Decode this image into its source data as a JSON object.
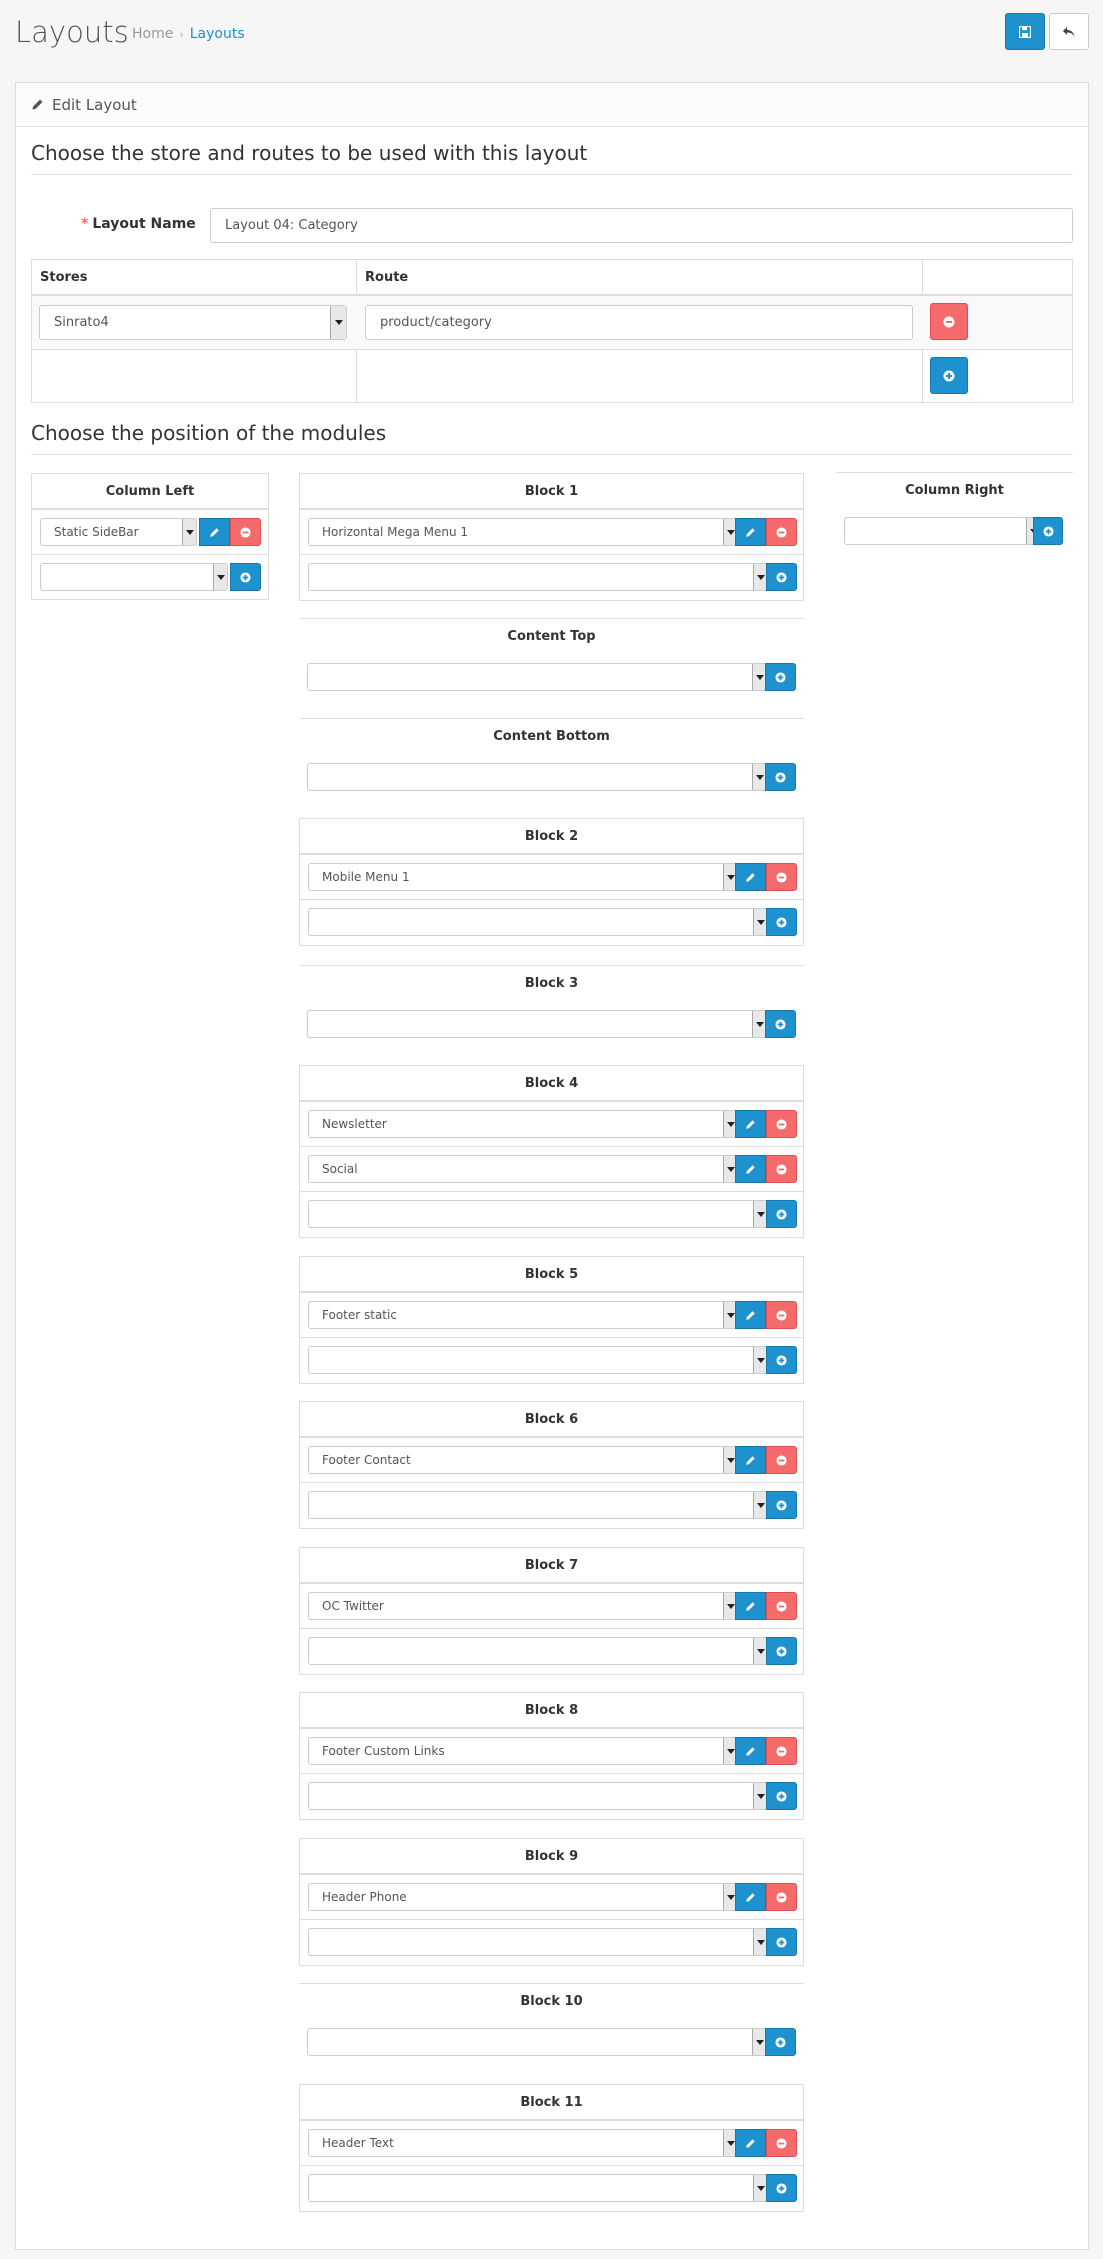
{
  "header": {
    "title": "Layouts",
    "breadcrumb": [
      "Home",
      "Layouts"
    ],
    "breadcrumb_sep": "›"
  },
  "panel": {
    "heading": "Edit Layout"
  },
  "section1": {
    "legend": "Choose the store and routes to be used with this layout"
  },
  "layout_name": {
    "label": "Layout Name",
    "required_mark": "*",
    "value": "Layout 04: Category"
  },
  "routes_table": {
    "headers": [
      "Stores",
      "Route",
      ""
    ],
    "rows": [
      {
        "store": "Sinrato4",
        "route": "product/category"
      }
    ]
  },
  "section2": {
    "legend": "Choose the position of the modules"
  },
  "positions": {
    "column_left": {
      "title": "Column Left",
      "modules": [
        "Static SideBar"
      ]
    },
    "column_right": {
      "title": "Column Right",
      "modules": []
    },
    "block1": {
      "title": "Block 1",
      "modules": [
        "Horizontal Mega Menu 1"
      ]
    },
    "content_top": {
      "title": "Content Top",
      "modules": []
    },
    "content_bottom": {
      "title": "Content Bottom",
      "modules": []
    },
    "block2": {
      "title": "Block 2",
      "modules": [
        "Mobile Menu 1"
      ]
    },
    "block3": {
      "title": "Block 3",
      "modules": []
    },
    "block4": {
      "title": "Block 4",
      "modules": [
        "Newsletter",
        "Social"
      ]
    },
    "block5": {
      "title": "Block 5",
      "modules": [
        "Footer static"
      ]
    },
    "block6": {
      "title": "Block 6",
      "modules": [
        "Footer Contact"
      ]
    },
    "block7": {
      "title": "Block 7",
      "modules": [
        "OC Twitter"
      ]
    },
    "block8": {
      "title": "Block 8",
      "modules": [
        "Footer Custom Links"
      ]
    },
    "block9": {
      "title": "Block 9",
      "modules": [
        "Header Phone"
      ]
    },
    "block10": {
      "title": "Block 10",
      "modules": []
    },
    "block11": {
      "title": "Block 11",
      "modules": [
        "Header Text"
      ]
    }
  },
  "colors": {
    "primary": "#1e91cf",
    "danger": "#f56b6b",
    "border": "#dddddd"
  }
}
